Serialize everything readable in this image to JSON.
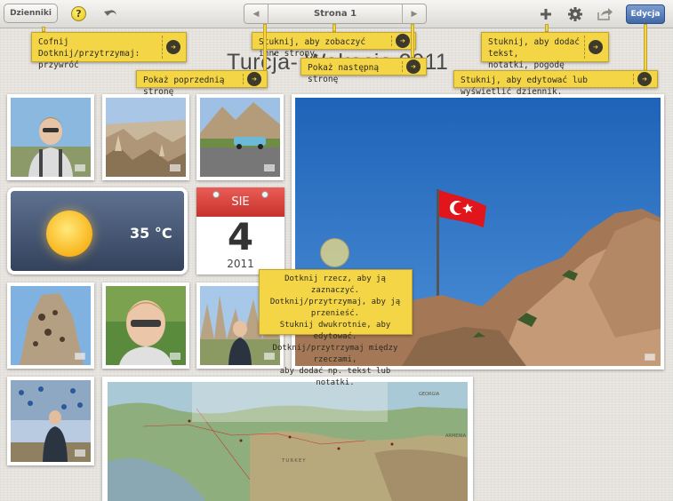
{
  "toolbar": {
    "journals_label": "Dzienniki",
    "help_label": "?",
    "page_label": "Strona 1",
    "edit_label": "Edycja"
  },
  "page": {
    "title": "Turcja- Wakacje 2011"
  },
  "tooltips": {
    "undo": [
      "Cofnij",
      "Dotknij/przytrzymaj: przywróć"
    ],
    "prev": "Pokaż poprzednią stronę",
    "pages": "Stuknij, aby zobaczyć inne strony.",
    "next": "Pokaż następną stronę",
    "add": [
      "Stuknij, aby dodać tekst,",
      "notatki, pogodę itp."
    ],
    "edit": "Stuknij, aby edytować lub wyświetlić dziennik.",
    "select": [
      "Dotknij rzecz, aby ją zaznaczyć.",
      "Dotknij/przytrzymaj, aby ją przenieść.",
      "Stuknij dwukrotnie, aby edytować.",
      "Dotknij/przytrzymaj między rzeczami,",
      "aby dodać np. tekst lub notatki."
    ]
  },
  "weather": {
    "temperature": "35 °C"
  },
  "calendar": {
    "month": "SIE",
    "day": "4",
    "year": "2011"
  },
  "map": {
    "labels": [
      "TURKEY",
      "ARMENIA",
      "GEORGIA"
    ]
  },
  "colors": {
    "tooltip": "#f4d545",
    "edit_button": "#3f67a8",
    "calendar_header": "#d63f38"
  }
}
